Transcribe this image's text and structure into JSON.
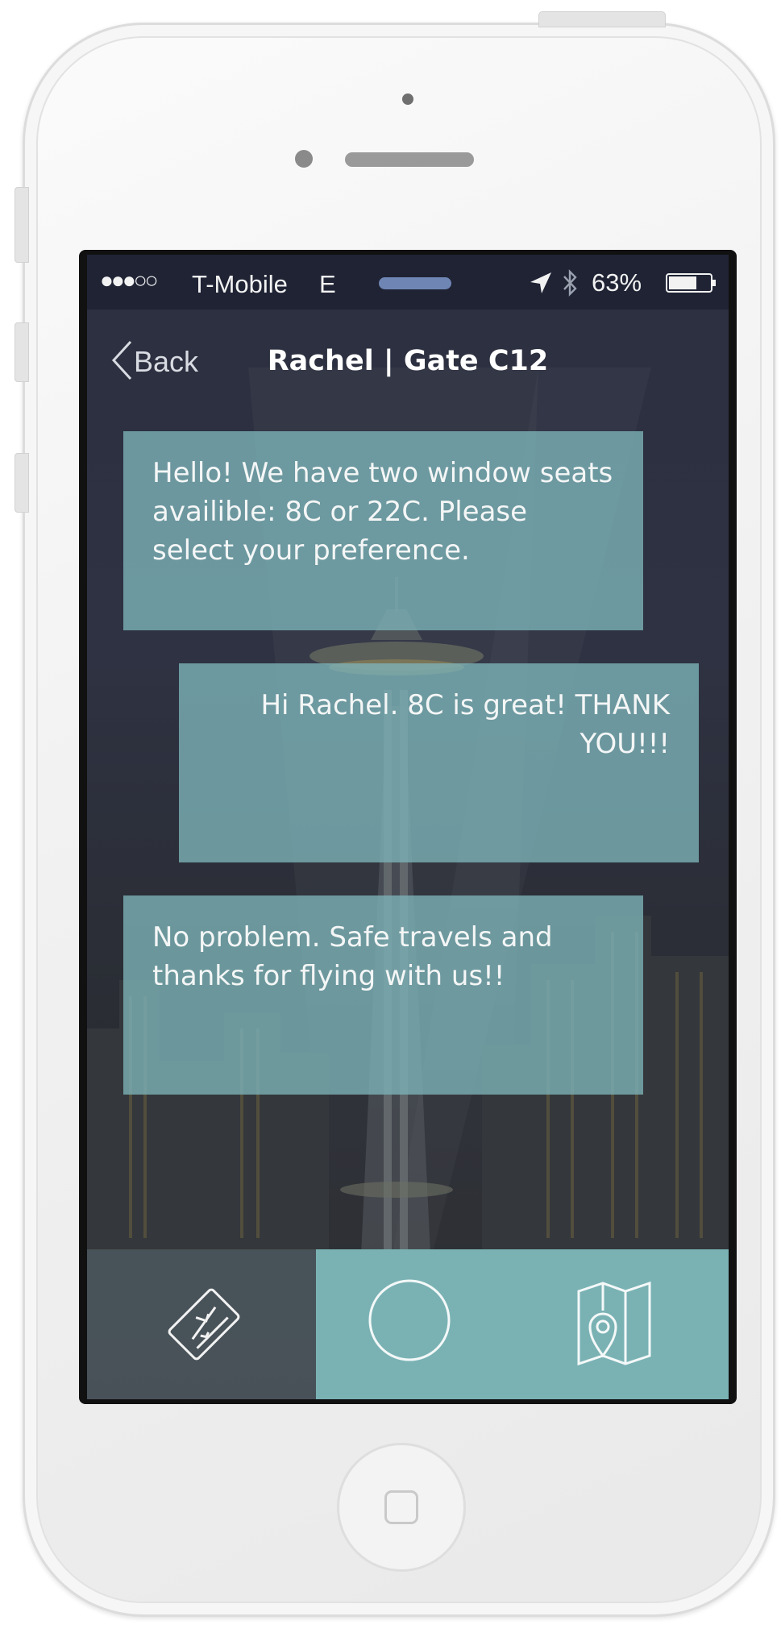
{
  "status_bar": {
    "signal": "●●●○○",
    "carrier": "T-Mobile",
    "network": "E",
    "battery": "63%",
    "icons": [
      "location-arrow-icon",
      "bluetooth-icon",
      "battery-icon"
    ]
  },
  "nav": {
    "back_label": "Back",
    "title": "Rachel | Gate C12"
  },
  "messages": [
    {
      "side": "left",
      "text": "Hello! We have two window seats availible: 8C or 22C. Please select your preference."
    },
    {
      "side": "right",
      "text": "Hi Rachel.  8C is great! THANK YOU!!!"
    },
    {
      "side": "left",
      "text": "No problem. Safe travels and thanks for flying with us!!"
    }
  ],
  "tab_bar": {
    "items": [
      {
        "icon": "boarding-pass-icon",
        "active": false
      },
      {
        "icon": "circle-home-icon",
        "active": true
      },
      {
        "icon": "map-pin-icon",
        "active": true
      }
    ]
  },
  "colors": {
    "bubble": "#7cb2b7",
    "tab_active": "#7ab2b4",
    "status_bar": "#1f2334",
    "background": "#2b2f3f"
  }
}
